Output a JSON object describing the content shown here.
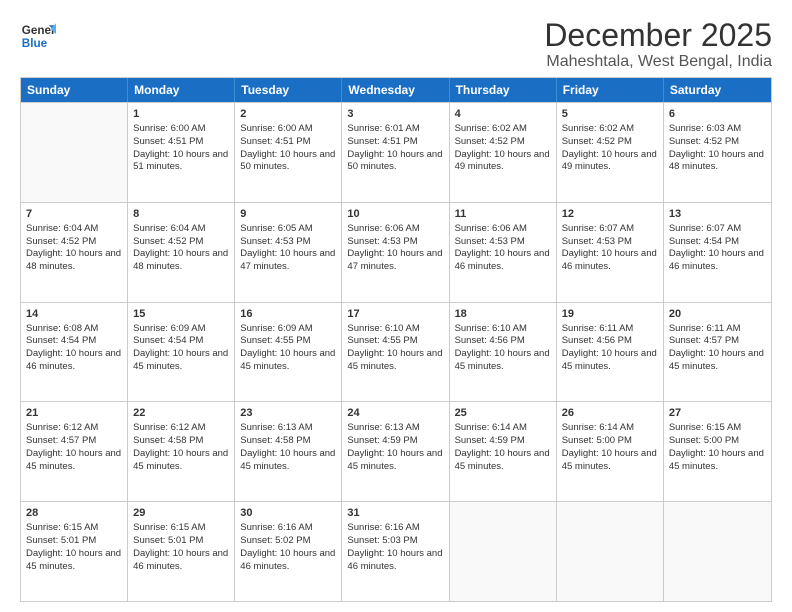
{
  "logo": {
    "line1": "General",
    "line2": "Blue"
  },
  "title": "December 2025",
  "location": "Maheshtala, West Bengal, India",
  "days_of_week": [
    "Sunday",
    "Monday",
    "Tuesday",
    "Wednesday",
    "Thursday",
    "Friday",
    "Saturday"
  ],
  "weeks": [
    [
      {
        "day": "",
        "sunrise": "",
        "sunset": "",
        "daylight": "",
        "empty": true
      },
      {
        "day": "1",
        "sunrise": "Sunrise: 6:00 AM",
        "sunset": "Sunset: 4:51 PM",
        "daylight": "Daylight: 10 hours and 51 minutes."
      },
      {
        "day": "2",
        "sunrise": "Sunrise: 6:00 AM",
        "sunset": "Sunset: 4:51 PM",
        "daylight": "Daylight: 10 hours and 50 minutes."
      },
      {
        "day": "3",
        "sunrise": "Sunrise: 6:01 AM",
        "sunset": "Sunset: 4:51 PM",
        "daylight": "Daylight: 10 hours and 50 minutes."
      },
      {
        "day": "4",
        "sunrise": "Sunrise: 6:02 AM",
        "sunset": "Sunset: 4:52 PM",
        "daylight": "Daylight: 10 hours and 49 minutes."
      },
      {
        "day": "5",
        "sunrise": "Sunrise: 6:02 AM",
        "sunset": "Sunset: 4:52 PM",
        "daylight": "Daylight: 10 hours and 49 minutes."
      },
      {
        "day": "6",
        "sunrise": "Sunrise: 6:03 AM",
        "sunset": "Sunset: 4:52 PM",
        "daylight": "Daylight: 10 hours and 48 minutes."
      }
    ],
    [
      {
        "day": "7",
        "sunrise": "Sunrise: 6:04 AM",
        "sunset": "Sunset: 4:52 PM",
        "daylight": "Daylight: 10 hours and 48 minutes."
      },
      {
        "day": "8",
        "sunrise": "Sunrise: 6:04 AM",
        "sunset": "Sunset: 4:52 PM",
        "daylight": "Daylight: 10 hours and 48 minutes."
      },
      {
        "day": "9",
        "sunrise": "Sunrise: 6:05 AM",
        "sunset": "Sunset: 4:53 PM",
        "daylight": "Daylight: 10 hours and 47 minutes."
      },
      {
        "day": "10",
        "sunrise": "Sunrise: 6:06 AM",
        "sunset": "Sunset: 4:53 PM",
        "daylight": "Daylight: 10 hours and 47 minutes."
      },
      {
        "day": "11",
        "sunrise": "Sunrise: 6:06 AM",
        "sunset": "Sunset: 4:53 PM",
        "daylight": "Daylight: 10 hours and 46 minutes."
      },
      {
        "day": "12",
        "sunrise": "Sunrise: 6:07 AM",
        "sunset": "Sunset: 4:53 PM",
        "daylight": "Daylight: 10 hours and 46 minutes."
      },
      {
        "day": "13",
        "sunrise": "Sunrise: 6:07 AM",
        "sunset": "Sunset: 4:54 PM",
        "daylight": "Daylight: 10 hours and 46 minutes."
      }
    ],
    [
      {
        "day": "14",
        "sunrise": "Sunrise: 6:08 AM",
        "sunset": "Sunset: 4:54 PM",
        "daylight": "Daylight: 10 hours and 46 minutes."
      },
      {
        "day": "15",
        "sunrise": "Sunrise: 6:09 AM",
        "sunset": "Sunset: 4:54 PM",
        "daylight": "Daylight: 10 hours and 45 minutes."
      },
      {
        "day": "16",
        "sunrise": "Sunrise: 6:09 AM",
        "sunset": "Sunset: 4:55 PM",
        "daylight": "Daylight: 10 hours and 45 minutes."
      },
      {
        "day": "17",
        "sunrise": "Sunrise: 6:10 AM",
        "sunset": "Sunset: 4:55 PM",
        "daylight": "Daylight: 10 hours and 45 minutes."
      },
      {
        "day": "18",
        "sunrise": "Sunrise: 6:10 AM",
        "sunset": "Sunset: 4:56 PM",
        "daylight": "Daylight: 10 hours and 45 minutes."
      },
      {
        "day": "19",
        "sunrise": "Sunrise: 6:11 AM",
        "sunset": "Sunset: 4:56 PM",
        "daylight": "Daylight: 10 hours and 45 minutes."
      },
      {
        "day": "20",
        "sunrise": "Sunrise: 6:11 AM",
        "sunset": "Sunset: 4:57 PM",
        "daylight": "Daylight: 10 hours and 45 minutes."
      }
    ],
    [
      {
        "day": "21",
        "sunrise": "Sunrise: 6:12 AM",
        "sunset": "Sunset: 4:57 PM",
        "daylight": "Daylight: 10 hours and 45 minutes."
      },
      {
        "day": "22",
        "sunrise": "Sunrise: 6:12 AM",
        "sunset": "Sunset: 4:58 PM",
        "daylight": "Daylight: 10 hours and 45 minutes."
      },
      {
        "day": "23",
        "sunrise": "Sunrise: 6:13 AM",
        "sunset": "Sunset: 4:58 PM",
        "daylight": "Daylight: 10 hours and 45 minutes."
      },
      {
        "day": "24",
        "sunrise": "Sunrise: 6:13 AM",
        "sunset": "Sunset: 4:59 PM",
        "daylight": "Daylight: 10 hours and 45 minutes."
      },
      {
        "day": "25",
        "sunrise": "Sunrise: 6:14 AM",
        "sunset": "Sunset: 4:59 PM",
        "daylight": "Daylight: 10 hours and 45 minutes."
      },
      {
        "day": "26",
        "sunrise": "Sunrise: 6:14 AM",
        "sunset": "Sunset: 5:00 PM",
        "daylight": "Daylight: 10 hours and 45 minutes."
      },
      {
        "day": "27",
        "sunrise": "Sunrise: 6:15 AM",
        "sunset": "Sunset: 5:00 PM",
        "daylight": "Daylight: 10 hours and 45 minutes."
      }
    ],
    [
      {
        "day": "28",
        "sunrise": "Sunrise: 6:15 AM",
        "sunset": "Sunset: 5:01 PM",
        "daylight": "Daylight: 10 hours and 45 minutes."
      },
      {
        "day": "29",
        "sunrise": "Sunrise: 6:15 AM",
        "sunset": "Sunset: 5:01 PM",
        "daylight": "Daylight: 10 hours and 46 minutes."
      },
      {
        "day": "30",
        "sunrise": "Sunrise: 6:16 AM",
        "sunset": "Sunset: 5:02 PM",
        "daylight": "Daylight: 10 hours and 46 minutes."
      },
      {
        "day": "31",
        "sunrise": "Sunrise: 6:16 AM",
        "sunset": "Sunset: 5:03 PM",
        "daylight": "Daylight: 10 hours and 46 minutes."
      },
      {
        "day": "",
        "sunrise": "",
        "sunset": "",
        "daylight": "",
        "empty": true
      },
      {
        "day": "",
        "sunrise": "",
        "sunset": "",
        "daylight": "",
        "empty": true
      },
      {
        "day": "",
        "sunrise": "",
        "sunset": "",
        "daylight": "",
        "empty": true
      }
    ]
  ]
}
